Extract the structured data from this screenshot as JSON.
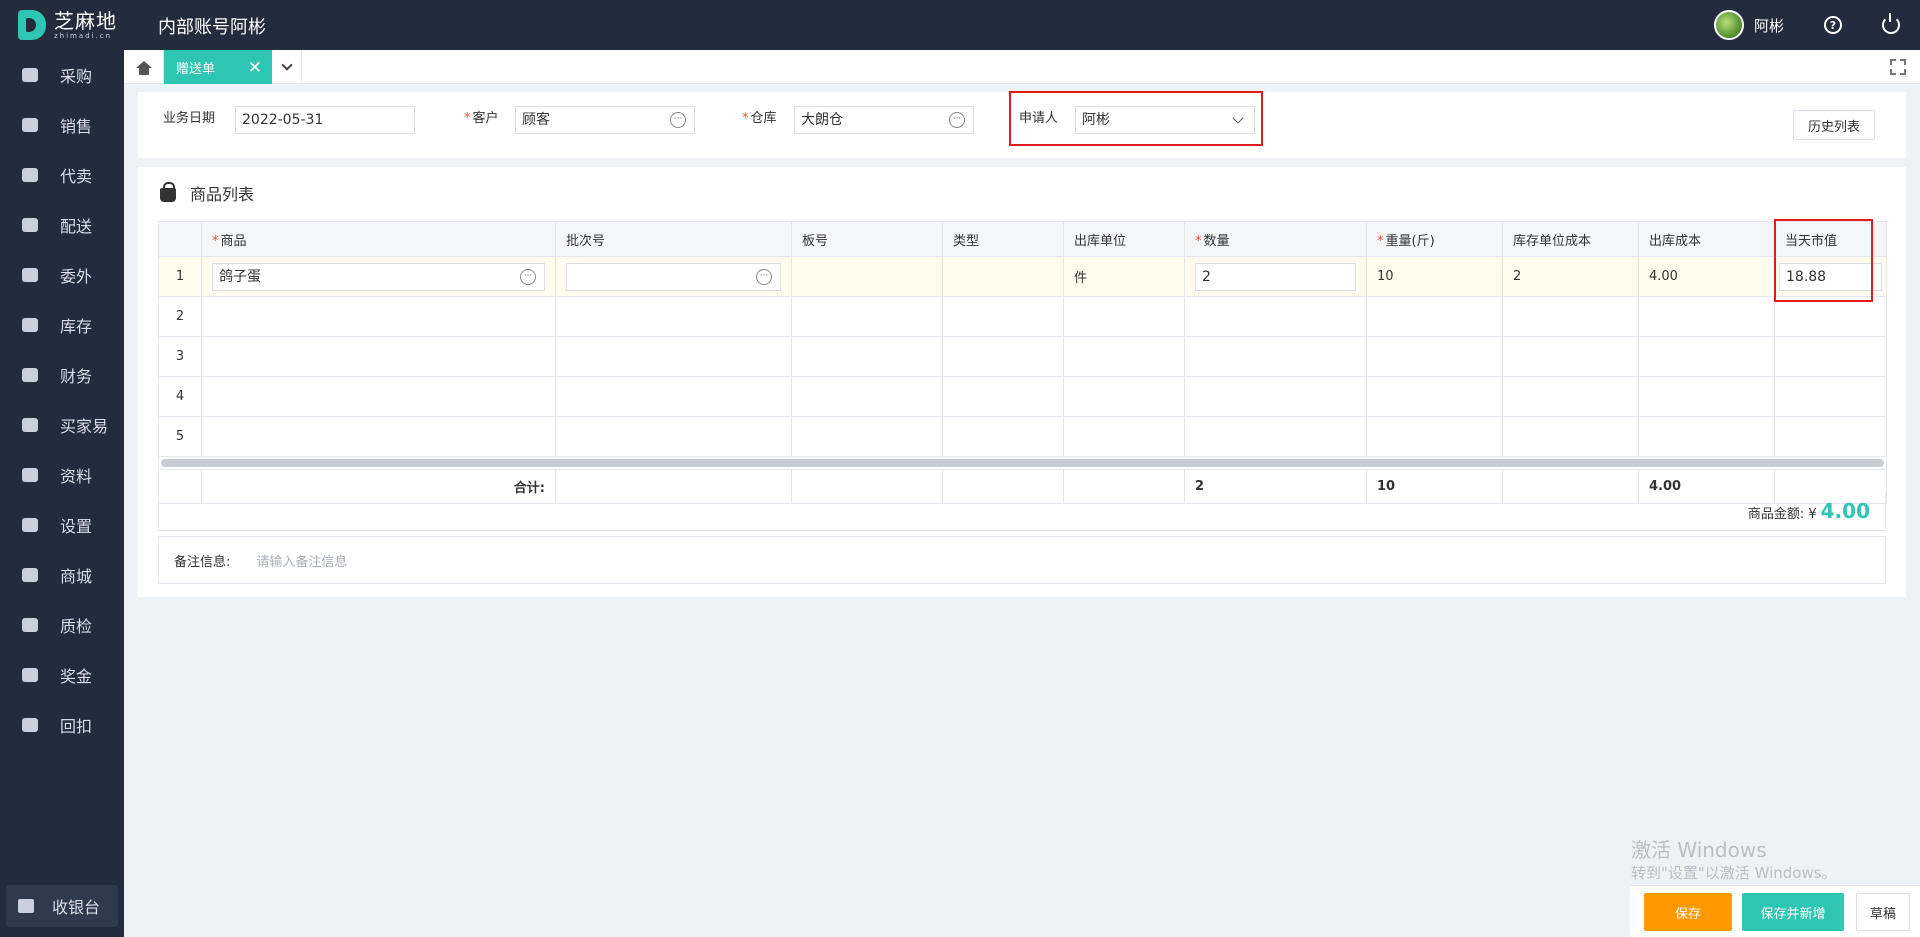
{
  "header": {
    "logo_cn": "芝麻地",
    "logo_en": "zhimadi.cn",
    "title": "内部账号阿彬",
    "user_name": "阿彬"
  },
  "sidebar": {
    "items": [
      {
        "label": "采购",
        "icon": "basket-icon"
      },
      {
        "label": "销售",
        "icon": "cart-icon"
      },
      {
        "label": "代卖",
        "icon": "tag-icon"
      },
      {
        "label": "配送",
        "icon": "truck-icon"
      },
      {
        "label": "委外",
        "icon": "building-icon"
      },
      {
        "label": "库存",
        "icon": "warehouse-icon"
      },
      {
        "label": "财务",
        "icon": "yen-shield-icon"
      },
      {
        "label": "买家易",
        "icon": "store-icon"
      },
      {
        "label": "资料",
        "icon": "printer-icon"
      },
      {
        "label": "设置",
        "icon": "gear-icon"
      },
      {
        "label": "商城",
        "icon": "store-icon"
      },
      {
        "label": "质检",
        "icon": "basket-icon"
      },
      {
        "label": "奖金",
        "icon": "store-icon"
      },
      {
        "label": "回扣",
        "icon": "building-icon"
      }
    ],
    "cashier": "收银台"
  },
  "tabs": {
    "active": "赠送单"
  },
  "form": {
    "date_label": "业务日期",
    "date_value": "2022-05-31",
    "customer_label": "客户",
    "customer_value": "顾客",
    "warehouse_label": "仓库",
    "warehouse_value": "大朗仓",
    "applicant_label": "申请人",
    "applicant_value": "阿彬",
    "history_button": "历史列表",
    "required_mark": "*"
  },
  "products": {
    "title": "商品列表",
    "columns": [
      "商品",
      "批次号",
      "板号",
      "类型",
      "出库单位",
      "数量",
      "重量(斤)",
      "库存单位成本",
      "出库成本",
      "当天市值"
    ],
    "required_columns": [
      "商品",
      "数量",
      "重量(斤)"
    ],
    "rows": [
      {
        "index": "1",
        "product": "鸽子蛋",
        "batch": "",
        "board": "",
        "type": "",
        "unit": "件",
        "quantity": "2",
        "weight": "10",
        "unit_cost": "2",
        "out_cost": "4.00",
        "market_value": "18.88"
      },
      {
        "index": "2"
      },
      {
        "index": "3"
      },
      {
        "index": "4"
      },
      {
        "index": "5"
      }
    ],
    "total_label": "合计:",
    "total_quantity": "2",
    "total_weight": "10",
    "total_out_cost": "4.00",
    "amount_label": "商品金额:",
    "amount_currency": "¥",
    "amount_value": "4.00",
    "remark_label": "备注信息:",
    "remark_placeholder": "请输入备注信息"
  },
  "watermark": {
    "line1": "激活 Windows",
    "line2": "转到\"设置\"以激活 Windows。"
  },
  "footer": {
    "save": "保存",
    "save_new": "保存并新增",
    "draft": "草稿"
  },
  "colors": {
    "accent": "#2ec5b3",
    "save_button": "#ff9900",
    "sidebar_bg": "#222c3c",
    "highlight_box": "#e01c1c"
  }
}
